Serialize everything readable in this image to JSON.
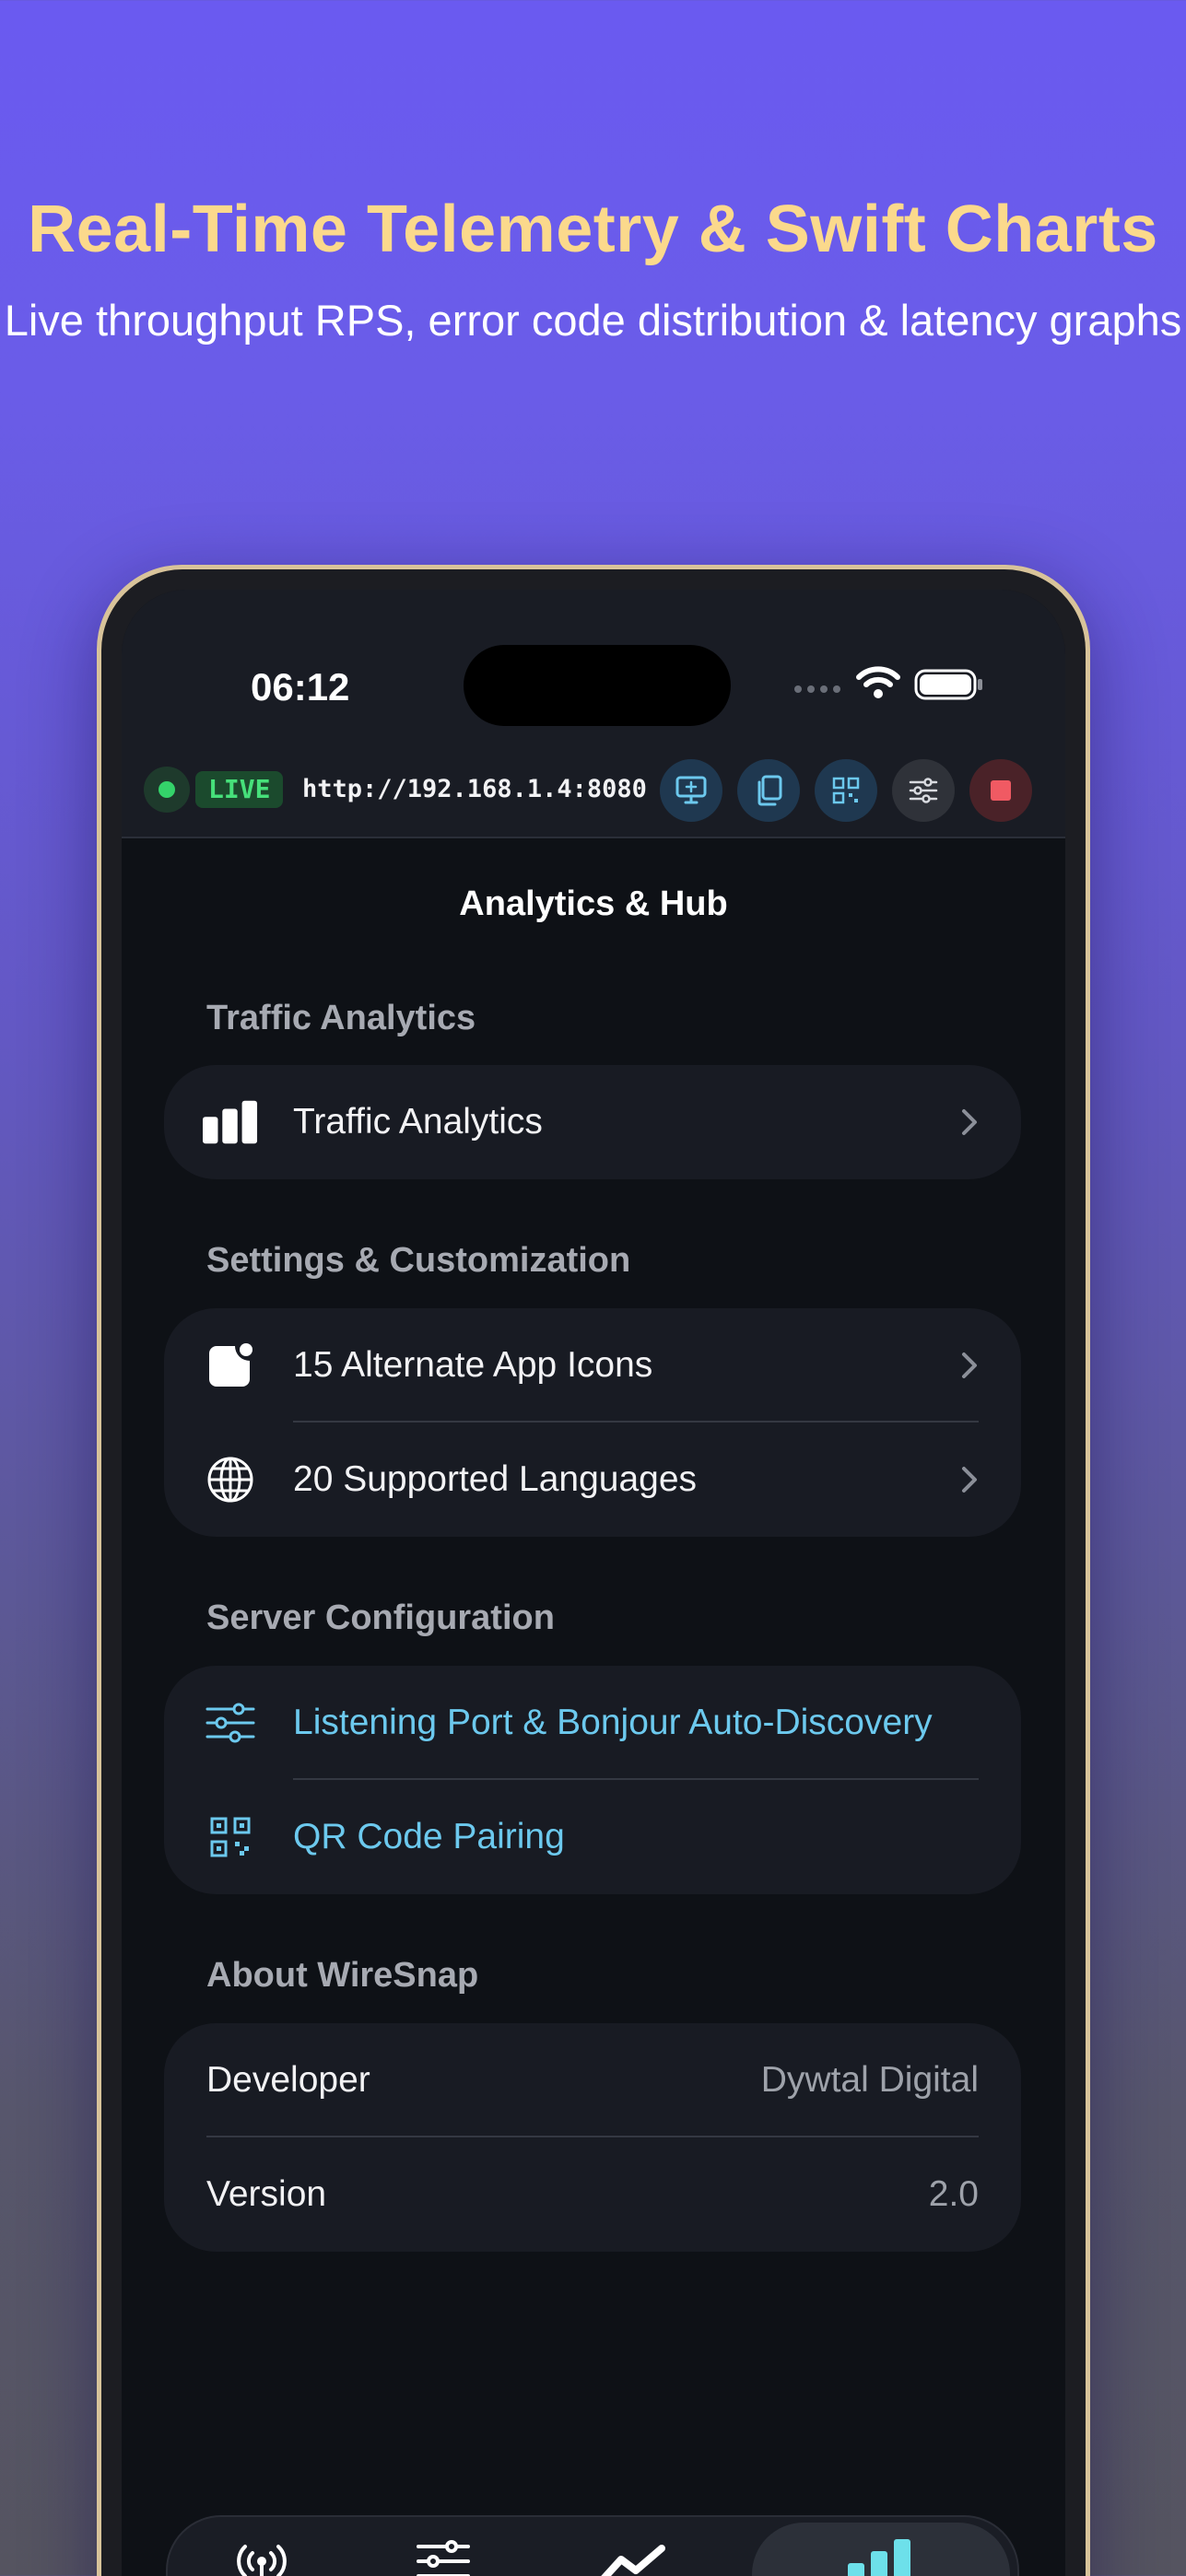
{
  "headline": "Real-Time Telemetry & Swift Charts",
  "subheadline": "Live throughput RPS, error code distribution & latency graphs",
  "status_bar": {
    "time": "06:12"
  },
  "toolbar": {
    "live_label": "LIVE",
    "url": "http://192.168.1.4:8080"
  },
  "nav_title": "Analytics & Hub",
  "sections": {
    "traffic": {
      "title": "Traffic Analytics",
      "items": [
        {
          "label": "Traffic Analytics",
          "icon": "chart-bar-icon"
        }
      ]
    },
    "settings": {
      "title": "Settings & Customization",
      "items": [
        {
          "label": "15 Alternate App Icons",
          "icon": "app-icon"
        },
        {
          "label": "20 Supported Languages",
          "icon": "globe-icon"
        }
      ]
    },
    "server": {
      "title": "Server Configuration",
      "items": [
        {
          "label": "Listening Port & Bonjour Auto-Discovery",
          "icon": "sliders-icon"
        },
        {
          "label": "QR Code Pairing",
          "icon": "qr-code-icon"
        }
      ]
    },
    "about": {
      "title": "About WireSnap",
      "rows": [
        {
          "label": "Developer",
          "value": "Dywtal Digital"
        },
        {
          "label": "Version",
          "value": "2.0"
        }
      ]
    }
  },
  "colors": {
    "accent": "#6cc9ee",
    "live_green": "#46e07a",
    "headline_gold": "#fbd98c",
    "stop_red": "#f05a63"
  }
}
